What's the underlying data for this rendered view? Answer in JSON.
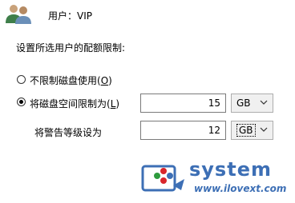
{
  "header": {
    "user_label": "用户：VIP",
    "icon": "users-icon"
  },
  "quota_prompt": "设置所选用户的配额限制:",
  "options": {
    "no_limit": {
      "label": "不限制磁盘使用(O)",
      "prefix": "不限制磁盘使用(",
      "key": "O",
      "suffix": ")",
      "selected": false
    },
    "limit": {
      "label": "将磁盘空间限制为(L)",
      "prefix": "将磁盘空间限制为(",
      "key": "L",
      "suffix": ")",
      "selected": true
    }
  },
  "limit_value": "15",
  "limit_unit": "GB",
  "warning": {
    "label": "将警告等级设为",
    "value": "12",
    "unit": "GB"
  },
  "watermark": {
    "title": "system",
    "url": "www.ilovext.com"
  },
  "colors": {
    "watermark_blue": "#3d6fb5",
    "logo_red": "#d9262b",
    "logo_green": "#2e9b3e"
  }
}
